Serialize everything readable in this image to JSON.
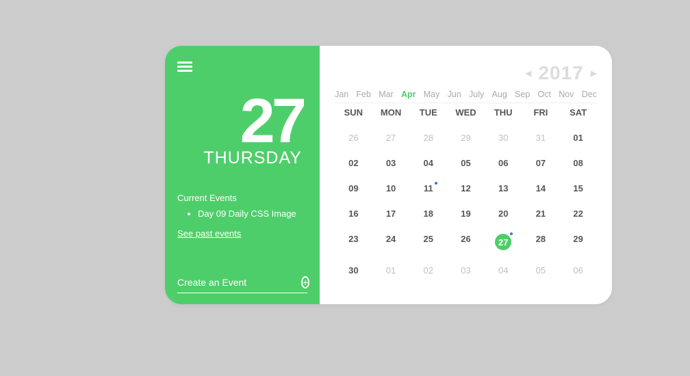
{
  "colors": {
    "accent": "#4ece6a"
  },
  "left": {
    "dayNumber": "27",
    "dayName": "THURSDAY",
    "eventsTitle": "Current Events",
    "events": [
      "Day 09 Daily CSS Image"
    ],
    "pastLink": "See past events",
    "createPlaceholder": "Create an Event"
  },
  "right": {
    "year": "2017",
    "months": [
      "Jan",
      "Feb",
      "Mar",
      "Apr",
      "May",
      "Jun",
      "July",
      "Aug",
      "Sep",
      "Oct",
      "Nov",
      "Dec"
    ],
    "activeMonthIndex": 3,
    "dow": [
      "SUN",
      "MON",
      "TUE",
      "WED",
      "THU",
      "FRI",
      "SAT"
    ],
    "days": [
      {
        "n": "26",
        "muted": true
      },
      {
        "n": "27",
        "muted": true
      },
      {
        "n": "28",
        "muted": true
      },
      {
        "n": "29",
        "muted": true
      },
      {
        "n": "30",
        "muted": true
      },
      {
        "n": "31",
        "muted": true
      },
      {
        "n": "01"
      },
      {
        "n": "02"
      },
      {
        "n": "03"
      },
      {
        "n": "04"
      },
      {
        "n": "05"
      },
      {
        "n": "06"
      },
      {
        "n": "07"
      },
      {
        "n": "08"
      },
      {
        "n": "09"
      },
      {
        "n": "10"
      },
      {
        "n": "11",
        "dot": true
      },
      {
        "n": "12"
      },
      {
        "n": "13"
      },
      {
        "n": "14"
      },
      {
        "n": "15"
      },
      {
        "n": "16"
      },
      {
        "n": "17"
      },
      {
        "n": "18"
      },
      {
        "n": "19"
      },
      {
        "n": "20"
      },
      {
        "n": "21"
      },
      {
        "n": "22"
      },
      {
        "n": "23"
      },
      {
        "n": "24"
      },
      {
        "n": "25"
      },
      {
        "n": "26"
      },
      {
        "n": "27",
        "today": true,
        "dot": true
      },
      {
        "n": "28"
      },
      {
        "n": "29"
      },
      {
        "n": "30"
      },
      {
        "n": "01",
        "muted": true
      },
      {
        "n": "02",
        "muted": true
      },
      {
        "n": "03",
        "muted": true
      },
      {
        "n": "04",
        "muted": true
      },
      {
        "n": "05",
        "muted": true
      },
      {
        "n": "06",
        "muted": true
      }
    ]
  }
}
